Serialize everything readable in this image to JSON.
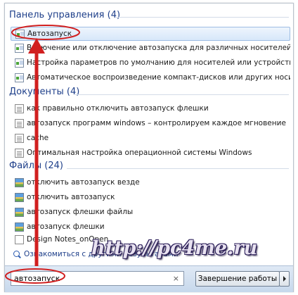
{
  "sections": {
    "control_panel": {
      "title": "Панель управления (4)",
      "items": [
        {
          "label": "Автозапуск"
        },
        {
          "label": "Включение или отключение автозапуска для различных носителей и устр..."
        },
        {
          "label": "Настройка параметров по умолчанию для носителей или устройств"
        },
        {
          "label": "Автоматическое воспроизведение компакт-дисков или других носителей"
        }
      ]
    },
    "documents": {
      "title": "Документы (4)",
      "items": [
        {
          "label": "как правильно отключить автозапуск флешки"
        },
        {
          "label": "автозапуск программ windows – контролируем каждое мгновение"
        },
        {
          "label": "cache"
        },
        {
          "label": "Оптимальная настройка операционной системы Windows"
        }
      ]
    },
    "files": {
      "title": "Файлы (24)",
      "items": [
        {
          "label": "отключить автозапуск везде"
        },
        {
          "label": "отключить автозапуск"
        },
        {
          "label": "автозапуск флешки файлы"
        },
        {
          "label": "автозапуск флешки"
        },
        {
          "label": "Design Notes_onOpen"
        }
      ]
    }
  },
  "see_more": "Ознакомиться с другими результатами",
  "search": {
    "value": "автозапуск",
    "clear": "×"
  },
  "shutdown_label": "Завершение работы",
  "watermark": "http://pc4me.ru",
  "annotation_color": "#d11f1f"
}
